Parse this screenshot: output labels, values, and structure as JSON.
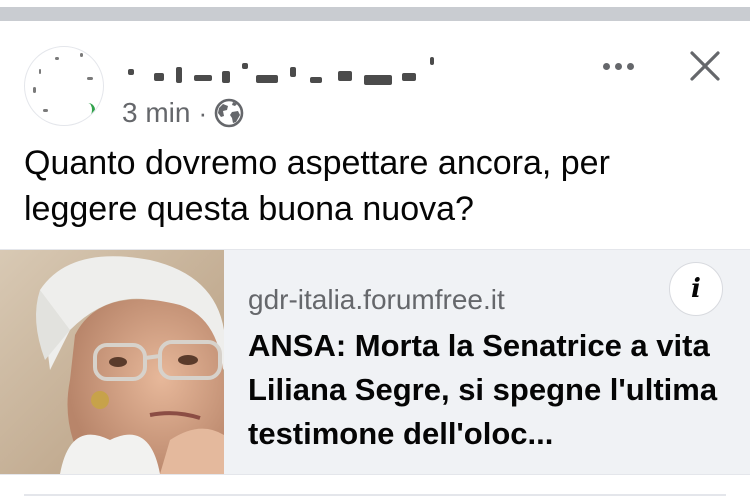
{
  "post": {
    "timestamp": "3 min",
    "separator": "·",
    "privacy_icon": "globe-icon",
    "text": "Quanto dovremo aspettare ancora, per leggere questa buona nuova?",
    "more_icon": "more-horizontal-icon",
    "close_icon": "close-icon"
  },
  "link_preview": {
    "domain": "gdr-italia.forumfree.it",
    "headline": "ANSA: Morta la Senatrice a vita Liliana Segre, si spegne l'ultima testimone dell'oloc...",
    "info_label": "i"
  },
  "colors": {
    "secondary_text": "#65676b",
    "card_background": "#f0f2f5",
    "divider": "#e4e6eb"
  }
}
